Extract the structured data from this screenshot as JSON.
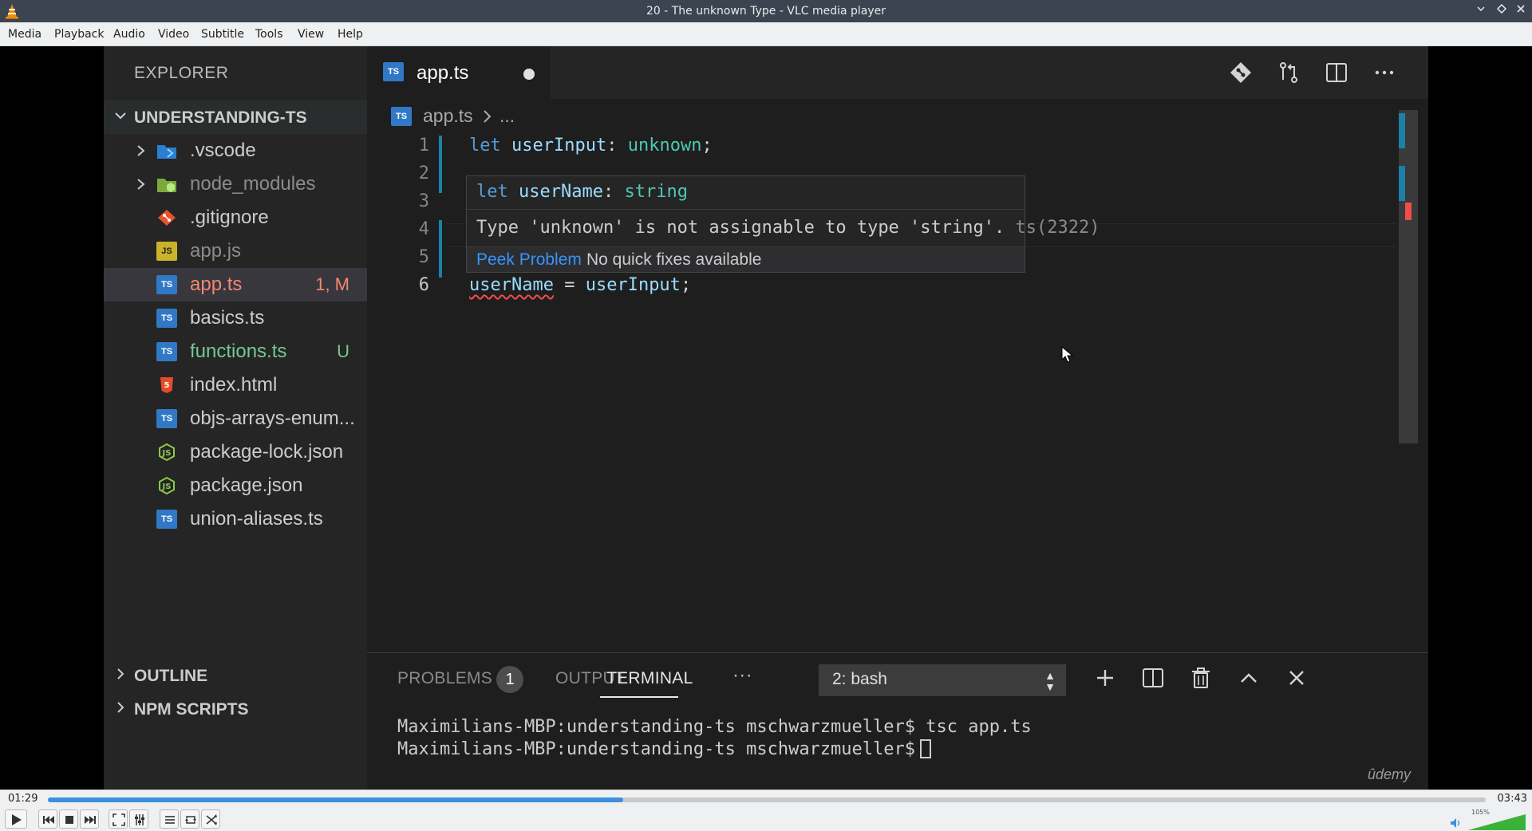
{
  "window": {
    "title": "20 - The unknown Type - VLC media player"
  },
  "menu": [
    "Media",
    "Playback",
    "Audio",
    "Video",
    "Subtitle",
    "Tools",
    "View",
    "Help"
  ],
  "explorer": {
    "title": "EXPLORER",
    "project": "UNDERSTANDING-TS",
    "files": [
      {
        "name": ".vscode",
        "icon": "folder-vscode-icon",
        "status": "",
        "color": "#cccccc"
      },
      {
        "name": "node_modules",
        "icon": "folder-node-icon",
        "status": "",
        "color": "#8c8c8c"
      },
      {
        "name": ".gitignore",
        "icon": "git-icon",
        "status": "",
        "color": "#cccccc"
      },
      {
        "name": "app.js",
        "icon": "js-file-icon",
        "status": "",
        "color": "#8c8c8c"
      },
      {
        "name": "app.ts",
        "icon": "ts-file-icon",
        "status": "1, M",
        "color": "#f48771"
      },
      {
        "name": "basics.ts",
        "icon": "ts-file-icon",
        "status": "",
        "color": "#cccccc"
      },
      {
        "name": "functions.ts",
        "icon": "ts-file-icon",
        "status": "U",
        "color": "#73c991"
      },
      {
        "name": "index.html",
        "icon": "html-file-icon",
        "status": "",
        "color": "#cccccc"
      },
      {
        "name": "objs-arrays-enum...",
        "icon": "ts-file-icon",
        "status": "",
        "color": "#cccccc"
      },
      {
        "name": "package-lock.json",
        "icon": "json-file-icon",
        "status": "",
        "color": "#cccccc"
      },
      {
        "name": "package.json",
        "icon": "json-file-icon",
        "status": "",
        "color": "#cccccc"
      },
      {
        "name": "union-aliases.ts",
        "icon": "ts-file-icon",
        "status": "",
        "color": "#cccccc"
      }
    ],
    "sections": [
      "OUTLINE",
      "NPM SCRIPTS"
    ]
  },
  "editor": {
    "tab": "app.ts",
    "ts_badge": "TS",
    "breadcrumb": {
      "file": "app.ts",
      "more": "..."
    },
    "line_numbers": [
      "1",
      "2",
      "3",
      "4",
      "5",
      "6"
    ],
    "line1": {
      "kw": "let",
      "name": "userInput",
      "colon": ":",
      "type": "unknown",
      "end": ";"
    },
    "line6": {
      "name": "userName",
      "op": " = ",
      "value": "userInput",
      "end": ";"
    },
    "hover": {
      "sig_kw": "let",
      "sig_name": "userName",
      "sig_colon": ":",
      "sig_type": "string",
      "message": "Type 'unknown' is not assignable to type 'string'.",
      "code": "ts(2322)",
      "peek": "Peek Problem",
      "no_fix": "No quick fixes available"
    }
  },
  "panel": {
    "tabs": {
      "problems": "PROBLEMS",
      "output": "OUTPUT",
      "terminal": "TERMINAL",
      "more": "···"
    },
    "problems_count": "1",
    "terminal_select": "2: bash",
    "terminal_lines": [
      "Maximilians-MBP:understanding-ts mschwarzmueller$ tsc app.ts",
      "Maximilians-MBP:understanding-ts mschwarzmueller$"
    ],
    "watermark": "ûdemy"
  },
  "player": {
    "elapsed": "01:29",
    "total": "03:43",
    "progress": 0.4,
    "volume_label": "105%",
    "volume": 1.05
  },
  "colors": {
    "vlc_bar": "#3b4450",
    "accent": "#3d8fd9",
    "ts_blue": "#3178c6",
    "error": "#f14c4c"
  }
}
